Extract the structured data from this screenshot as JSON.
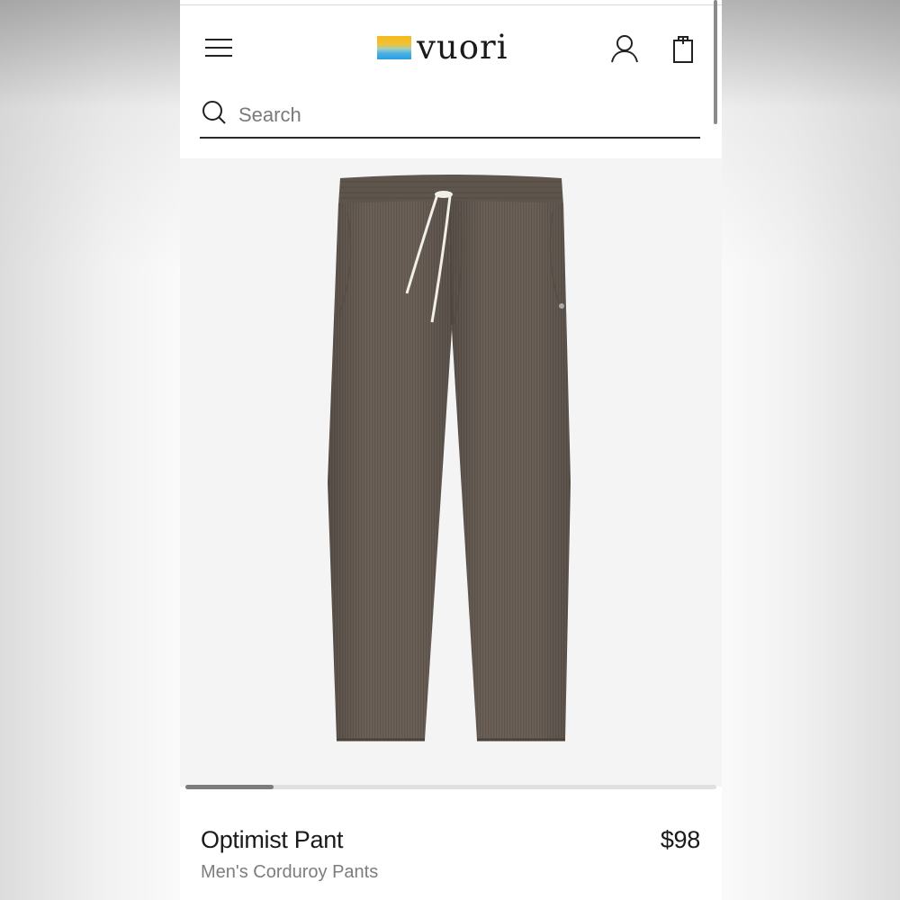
{
  "header": {
    "brand": "vuori",
    "menu_icon": "hamburger-menu-icon",
    "account_icon": "user-account-icon",
    "bag_icon": "shopping-bag-icon"
  },
  "search": {
    "placeholder": "Search",
    "value": "",
    "icon": "search-icon"
  },
  "gallery": {
    "image_alt": "Optimist Pant",
    "progress": 0.166
  },
  "product": {
    "name": "Optimist Pant",
    "price": "$98",
    "subtitle": "Men's Corduroy Pants",
    "color": "#6b5f55"
  },
  "colors": {
    "text": "#1a1a1a",
    "muted": "#7d7d7d",
    "image_bg": "#f4f4f4"
  }
}
